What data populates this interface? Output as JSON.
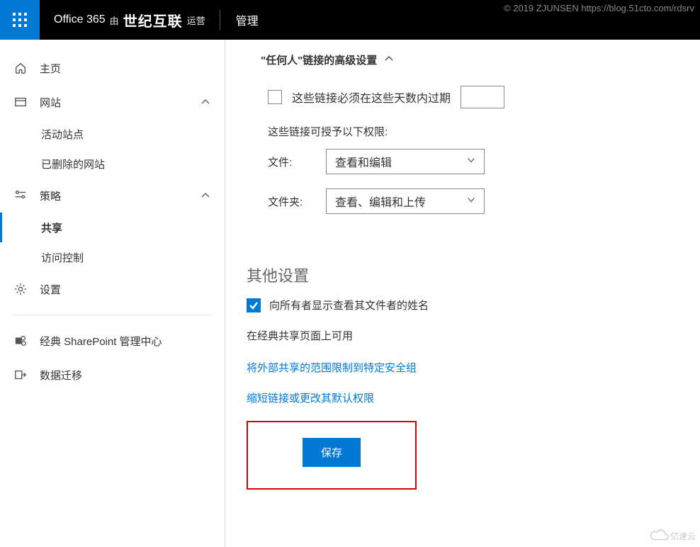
{
  "watermark": "© 2019 ZJUNSEN https://blog.51cto.com/rdsrv",
  "footer_logo": "亿速云",
  "header": {
    "brand_prefix": "Office 365",
    "brand_by": "由",
    "brand_logo": "世纪互联",
    "brand_suffix": "运营",
    "admin": "管理"
  },
  "sidebar": {
    "home": "主页",
    "site": "网站",
    "site_children": {
      "active": "活动站点",
      "deleted": "已删除的网站"
    },
    "policy": "策略",
    "policy_children": {
      "sharing": "共享",
      "access": "访问控制"
    },
    "settings": "设置",
    "classic": "经典 SharePoint 管理中心",
    "migration": "数据迁移"
  },
  "main": {
    "anyone_heading": "\"任何人\"链接的高级设置",
    "expire_label": "这些链接必须在这些天数内过期",
    "expire_value": "",
    "perm_intro": "这些链接可授予以下权限:",
    "file_label": "文件:",
    "file_value": "查看和编辑",
    "folder_label": "文件夹:",
    "folder_value": "查看、编辑和上传",
    "other_heading": "其他设置",
    "show_owner": "向所有者显示查看其文件者的姓名",
    "classic_note": "在经典共享页面上可用",
    "link1": "将外部共享的范围限制到特定安全组",
    "link2": "缩短链接或更改其默认权限",
    "save": "保存"
  }
}
